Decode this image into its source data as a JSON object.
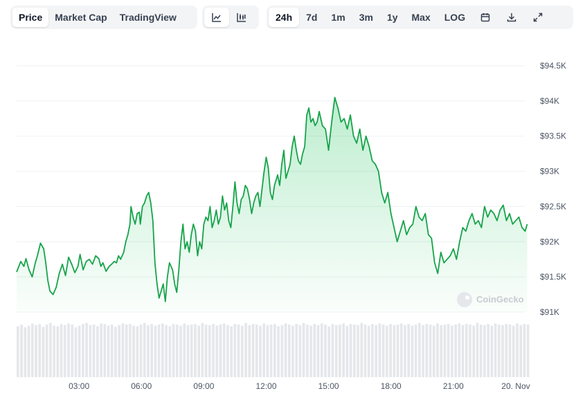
{
  "toolbar": {
    "view_tabs": [
      {
        "label": "Price",
        "active": true
      },
      {
        "label": "Market Cap",
        "active": false
      },
      {
        "label": "TradingView",
        "active": false
      }
    ],
    "chart_icons": [
      {
        "icon": "line-chart-icon",
        "active": true
      },
      {
        "icon": "candlestick-chart-icon",
        "active": false
      }
    ],
    "range_tabs": [
      {
        "label": "24h",
        "active": true
      },
      {
        "label": "7d",
        "active": false
      },
      {
        "label": "1m",
        "active": false
      },
      {
        "label": "3m",
        "active": false
      },
      {
        "label": "1y",
        "active": false
      },
      {
        "label": "Max",
        "active": false
      },
      {
        "label": "LOG",
        "active": false
      }
    ],
    "action_icons": [
      "calendar-icon",
      "download-icon",
      "expand-icon"
    ]
  },
  "watermark": {
    "text": "CoinGecko",
    "icon": "coingecko-logo-icon"
  },
  "colors": {
    "line": "#16a34a",
    "fill": "#22c55e",
    "volume": "#e5e7eb",
    "grid": "#eef0f2",
    "axis_text": "#4b5563"
  },
  "chart_data": {
    "type": "area",
    "title": "",
    "xlabel": "",
    "ylabel": "",
    "x_ticks": [
      "03:00",
      "06:00",
      "09:00",
      "12:00",
      "15:00",
      "18:00",
      "21:00",
      "20. Nov"
    ],
    "x_tick_hours": [
      3,
      6,
      9,
      12,
      15,
      18,
      21,
      24
    ],
    "x_range_hours": [
      0.0,
      24.7
    ],
    "y_ticks": [
      "$94.5K",
      "$94K",
      "$93.5K",
      "$93K",
      "$92.5K",
      "$92K",
      "$91.5K",
      "$91K"
    ],
    "y_tick_values": [
      94500,
      94000,
      93500,
      93000,
      92500,
      92000,
      91500,
      91000
    ],
    "ylim": [
      91000,
      94500
    ],
    "grid": true,
    "series": [
      {
        "x_hours": [
          0.0,
          0.2,
          0.35,
          0.45,
          0.6,
          0.75,
          0.9,
          1.0,
          1.15,
          1.3,
          1.4,
          1.5,
          1.6,
          1.75,
          1.9,
          2.05,
          2.2,
          2.35,
          2.5,
          2.65,
          2.8,
          2.95,
          3.05,
          3.2,
          3.35,
          3.5,
          3.65,
          3.8,
          3.95,
          4.05,
          4.15,
          4.3,
          4.45,
          4.6,
          4.7,
          4.8,
          4.9,
          5.0,
          5.15,
          5.25,
          5.35,
          5.45,
          5.5,
          5.6,
          5.7,
          5.8,
          5.9,
          5.95,
          6.05,
          6.15,
          6.25,
          6.35,
          6.45,
          6.55,
          6.65,
          6.75,
          6.85,
          6.95,
          7.05,
          7.15,
          7.25,
          7.35,
          7.5,
          7.6,
          7.7,
          7.8,
          7.9,
          8.0,
          8.1,
          8.2,
          8.3,
          8.4,
          8.5,
          8.6,
          8.7,
          8.8,
          8.9,
          9.0,
          9.1,
          9.2,
          9.3,
          9.4,
          9.5,
          9.6,
          9.7,
          9.8,
          9.9,
          10.0,
          10.1,
          10.2,
          10.3,
          10.4,
          10.5,
          10.6,
          10.7,
          10.8,
          10.9,
          11.0,
          11.1,
          11.2,
          11.3,
          11.4,
          11.5,
          11.6,
          11.7,
          11.8,
          11.9,
          12.0,
          12.1,
          12.2,
          12.3,
          12.4,
          12.55,
          12.65,
          12.75,
          12.85,
          12.95,
          13.05,
          13.15,
          13.25,
          13.35,
          13.45,
          13.55,
          13.65,
          13.75,
          13.85,
          13.95,
          14.05,
          14.15,
          14.25,
          14.35,
          14.45,
          14.55,
          14.7,
          14.85,
          15.0,
          15.15,
          15.3,
          15.45,
          15.6,
          15.75,
          15.9,
          16.05,
          16.2,
          16.35,
          16.5,
          16.65,
          16.8,
          16.95,
          17.1,
          17.25,
          17.4,
          17.55,
          17.7,
          17.85,
          18.0,
          18.15,
          18.3,
          18.45,
          18.6,
          18.75,
          18.9,
          19.05,
          19.2,
          19.35,
          19.5,
          19.65,
          19.8,
          19.95,
          20.1,
          20.25,
          20.4,
          20.55,
          20.7,
          20.85,
          21.0,
          21.15,
          21.3,
          21.45,
          21.6,
          21.75,
          21.9,
          22.05,
          22.2,
          22.35,
          22.5,
          22.65,
          22.8,
          22.95,
          23.1,
          23.25,
          23.4,
          23.55,
          23.7,
          23.85,
          24.0,
          24.15,
          24.3,
          24.45,
          24.55
        ],
        "values": [
          91570,
          91720,
          91650,
          91760,
          91600,
          91500,
          91700,
          91800,
          91980,
          91900,
          91700,
          91450,
          91300,
          91250,
          91350,
          91550,
          91680,
          91520,
          91780,
          91680,
          91560,
          91650,
          91820,
          91600,
          91720,
          91750,
          91680,
          91800,
          91760,
          91650,
          91700,
          91580,
          91650,
          91690,
          91720,
          91700,
          91800,
          91750,
          91850,
          92000,
          92100,
          92250,
          92500,
          92350,
          92250,
          92400,
          92420,
          92250,
          92500,
          92550,
          92650,
          92700,
          92550,
          92300,
          91700,
          91400,
          91200,
          91300,
          91400,
          91150,
          91500,
          91700,
          91600,
          91400,
          91280,
          91600,
          92000,
          92250,
          91900,
          92000,
          91850,
          92100,
          92250,
          92150,
          91800,
          92000,
          91900,
          92250,
          92350,
          92300,
          92500,
          92200,
          92300,
          92450,
          92250,
          92350,
          92650,
          92450,
          92550,
          92300,
          92200,
          92500,
          92850,
          92550,
          92400,
          92600,
          92650,
          92800,
          92750,
          92600,
          92400,
          92550,
          92650,
          92700,
          92500,
          92750,
          93000,
          93200,
          93050,
          92700,
          92600,
          92800,
          92950,
          92800,
          93100,
          93300,
          92900,
          93000,
          93100,
          93350,
          93500,
          93300,
          93150,
          93100,
          93250,
          93350,
          93800,
          93900,
          93700,
          93750,
          93650,
          93700,
          93850,
          93650,
          93600,
          93300,
          93700,
          94050,
          93900,
          93700,
          93750,
          93600,
          93800,
          93500,
          93400,
          93600,
          93300,
          93500,
          93350,
          93150,
          93100,
          93000,
          92700,
          92550,
          92700,
          92400,
          92200,
          92000,
          92150,
          92300,
          92100,
          92200,
          92250,
          92500,
          92350,
          92300,
          92400,
          92100,
          92050,
          91700,
          91550,
          91850,
          91700,
          91750,
          91800,
          91900,
          91750,
          92000,
          92200,
          92150,
          92300,
          92400,
          92250,
          92300,
          92200,
          92500,
          92350,
          92450,
          92400,
          92300,
          92450,
          92520,
          92300,
          92400,
          92250,
          92300,
          92350,
          92200,
          92150,
          92250,
          92100,
          92000,
          92200,
          92100,
          92050,
          92150,
          91950,
          91800,
          92050,
          91900,
          92100,
          91950,
          91900,
          92150,
          92100,
          91950,
          91800,
          91700,
          91900,
          91800,
          91750,
          91850,
          91900,
          92100,
          92000,
          92150,
          92050,
          92150,
          92300,
          92100,
          92150,
          92250,
          92200,
          92350,
          92250,
          92300,
          92450,
          92350,
          92200,
          92100,
          92150,
          92250,
          92400,
          92500,
          92650,
          92600,
          92550,
          92700,
          92650,
          92600,
          92550,
          92500,
          92450,
          92600,
          92550,
          92400,
          92550,
          92650,
          92750,
          92850,
          92800,
          92900,
          92850,
          92900,
          93000,
          92950,
          93100,
          93150
        ]
      }
    ],
    "volume_relative": [
      0.92,
      0.95,
      0.9,
      0.93,
      0.97,
      0.94,
      0.96,
      0.91,
      0.95,
      0.98,
      0.93,
      0.92,
      0.96,
      0.94,
      0.97,
      0.95,
      0.9,
      0.93,
      0.96,
      0.98,
      0.94,
      0.95,
      0.92,
      0.97,
      0.96,
      0.93,
      0.95,
      0.91,
      0.94,
      0.97,
      0.95,
      0.96,
      0.93,
      0.92,
      0.95,
      0.98,
      0.94,
      0.96,
      0.93,
      0.95,
      0.97,
      0.94,
      0.92,
      0.96,
      0.95,
      0.93,
      0.97,
      0.94,
      0.95,
      0.96,
      0.93,
      0.98,
      0.95,
      0.94,
      0.96,
      0.93,
      0.95,
      0.97,
      0.94,
      0.92,
      0.96,
      0.95,
      0.93,
      0.98,
      0.94,
      0.96,
      0.95,
      0.93,
      0.97,
      0.94,
      0.95,
      0.96,
      0.92,
      0.94,
      0.97,
      0.95,
      0.93,
      0.96,
      0.94,
      0.98,
      0.95,
      0.93,
      0.96,
      0.94,
      0.97,
      0.95,
      0.92,
      0.96,
      0.94,
      0.95,
      0.97,
      0.93,
      0.96,
      0.95,
      0.94,
      0.98,
      0.95,
      0.93,
      0.96,
      0.94,
      0.97,
      0.95,
      0.93,
      0.96,
      0.94,
      0.95,
      0.97,
      0.94,
      0.96,
      0.93,
      0.95,
      0.98,
      0.94,
      0.96,
      0.95,
      0.93,
      0.97,
      0.94,
      0.95,
      0.96,
      0.93,
      0.95,
      0.97,
      0.94,
      0.96,
      0.95,
      0.93,
      0.98,
      0.95,
      0.94,
      0.96,
      0.93,
      0.97,
      0.95,
      0.94,
      0.96,
      0.95,
      0.93,
      0.97,
      0.94,
      0.96,
      0.95
    ]
  }
}
